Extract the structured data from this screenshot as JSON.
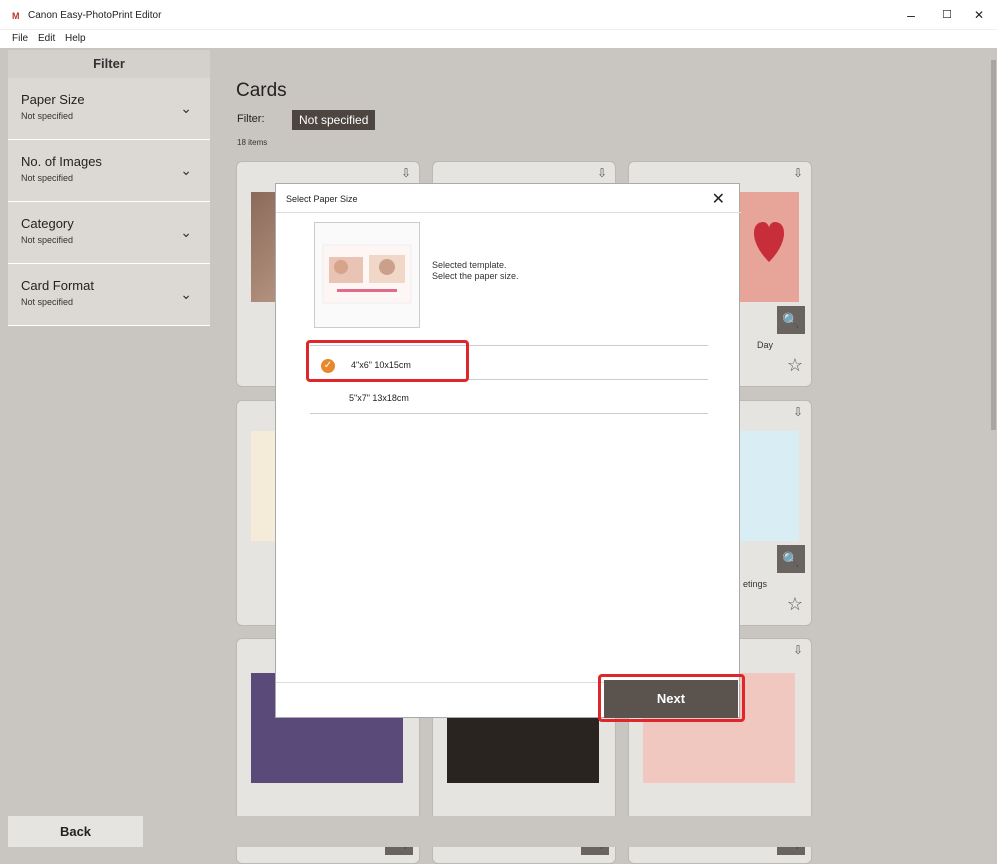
{
  "window": {
    "app_icon": "M",
    "title": "Canon Easy-PhotoPrint Editor",
    "minimize": "–",
    "maximize": "☐",
    "close": "✕"
  },
  "menu": [
    "File",
    "Edit",
    "Help"
  ],
  "sidebar": {
    "header": "Filter",
    "items": [
      {
        "label": "Paper Size",
        "value": "Not specified"
      },
      {
        "label": "No. of Images",
        "value": "Not specified"
      },
      {
        "label": "Category",
        "value": "Not specified"
      },
      {
        "label": "Card Format",
        "value": "Not specified"
      }
    ]
  },
  "main": {
    "title": "Cards",
    "filter_label": "Filter:",
    "filter_value": "Not specified",
    "items_count": "18 items"
  },
  "cards": [
    {
      "name": ""
    },
    {
      "name": ""
    },
    {
      "name": "Day"
    },
    {
      "name": ""
    },
    {
      "name": ""
    },
    {
      "name": "etings"
    },
    {
      "name": ""
    },
    {
      "name": ""
    },
    {
      "name": ""
    }
  ],
  "dialog": {
    "title": "Select Paper Size",
    "description_line1": "Selected template.",
    "description_line2": "Select the paper size.",
    "options": [
      {
        "label": "4\"x6\" 10x15cm",
        "selected": true
      },
      {
        "label": "5\"x7\" 13x18cm",
        "selected": false
      }
    ],
    "next_label": "Next"
  },
  "footer": {
    "back_label": "Back"
  },
  "colors": {
    "accent": "#e8882c",
    "highlight": "#e0262b",
    "button": "#5b534e",
    "chip": "#4d4640"
  }
}
